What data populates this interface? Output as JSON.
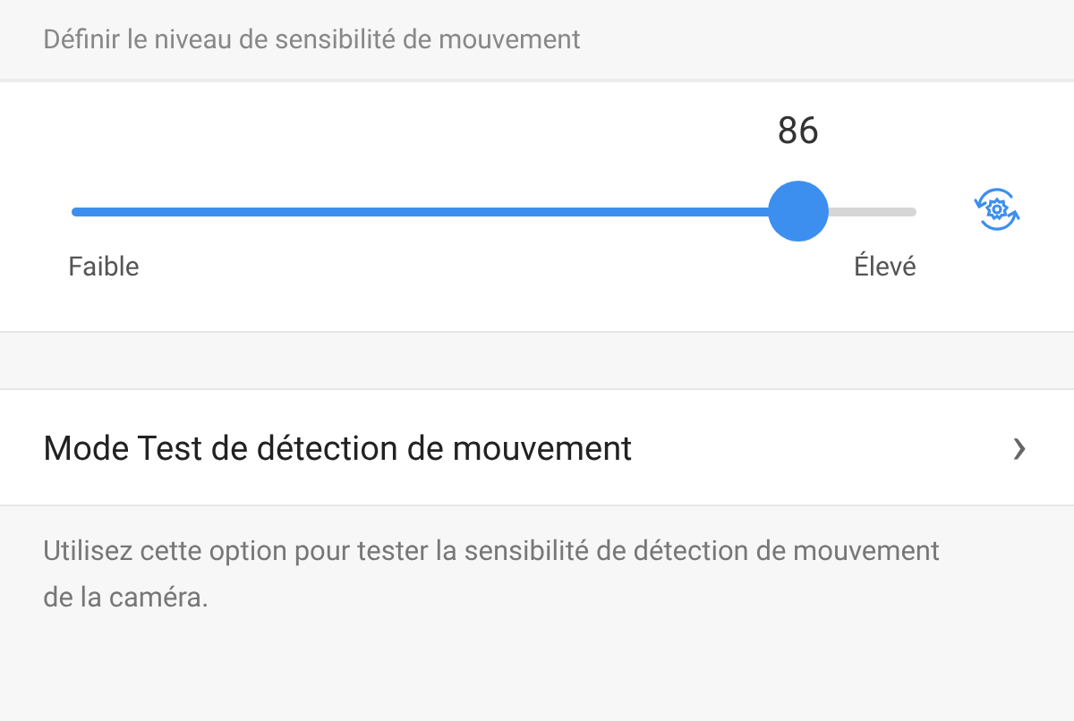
{
  "section_header": "Définir le niveau de sensibilité de mouvement",
  "sensitivity": {
    "value": "86",
    "level": 0.86,
    "min_label": "Faible",
    "max_label": "Élevé"
  },
  "test_mode": {
    "label": "Mode Test de détection de mouvement",
    "chevron": "›",
    "description": "Utilisez cette option pour tester la sensibilité de détection de mouvement de la caméra."
  }
}
